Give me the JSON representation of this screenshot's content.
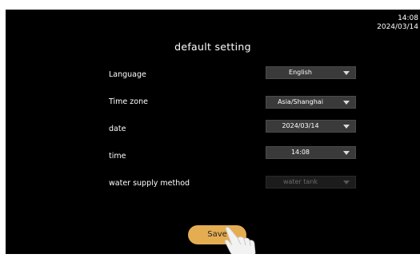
{
  "clock": {
    "time": "14:08",
    "date": "2024/03/14"
  },
  "page": {
    "title": "default setting"
  },
  "settings": [
    {
      "label": "Language",
      "value": "English",
      "disabled": false
    },
    {
      "label": "Time zone",
      "value": "Asia/Shanghai",
      "disabled": false
    },
    {
      "label": "date",
      "value": "2024/03/14",
      "disabled": false
    },
    {
      "label": "time",
      "value": "14:08",
      "disabled": false
    },
    {
      "label": "water supply method",
      "value": "water tank",
      "disabled": true
    }
  ],
  "actions": {
    "save_label": "Save"
  },
  "colors": {
    "background": "#000000",
    "accent": "#e5ad52",
    "select_bg": "#3a3a3a"
  },
  "icons": {
    "dropdown": "triangle-down-icon",
    "pointer": "hand-pointer-icon"
  }
}
